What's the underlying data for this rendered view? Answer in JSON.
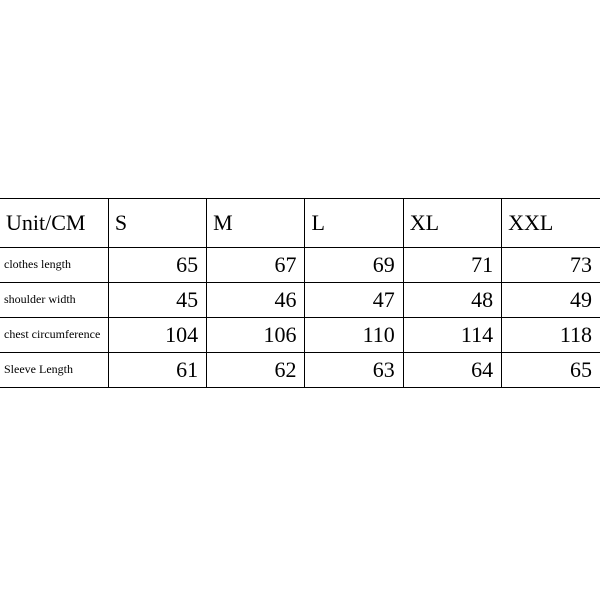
{
  "unit_label": "Unit/CM",
  "sizes": [
    "S",
    "M",
    "L",
    "XL",
    "XXL"
  ],
  "rows": [
    {
      "label": "clothes length",
      "values": [
        65,
        67,
        69,
        71,
        73
      ]
    },
    {
      "label": "shoulder width",
      "values": [
        45,
        46,
        47,
        48,
        49
      ]
    },
    {
      "label": "chest circumference",
      "values": [
        104,
        106,
        110,
        114,
        118
      ]
    },
    {
      "label": "Sleeve Length",
      "values": [
        61,
        62,
        63,
        64,
        65
      ]
    }
  ],
  "chart_data": {
    "type": "table",
    "title": "Unit/CM",
    "columns": [
      "S",
      "M",
      "L",
      "XL",
      "XXL"
    ],
    "rows": [
      {
        "name": "clothes length",
        "values": [
          65,
          67,
          69,
          71,
          73
        ]
      },
      {
        "name": "shoulder width",
        "values": [
          45,
          46,
          47,
          48,
          49
        ]
      },
      {
        "name": "chest circumference",
        "values": [
          104,
          106,
          110,
          114,
          118
        ]
      },
      {
        "name": "Sleeve Length",
        "values": [
          61,
          62,
          63,
          64,
          65
        ]
      }
    ]
  }
}
